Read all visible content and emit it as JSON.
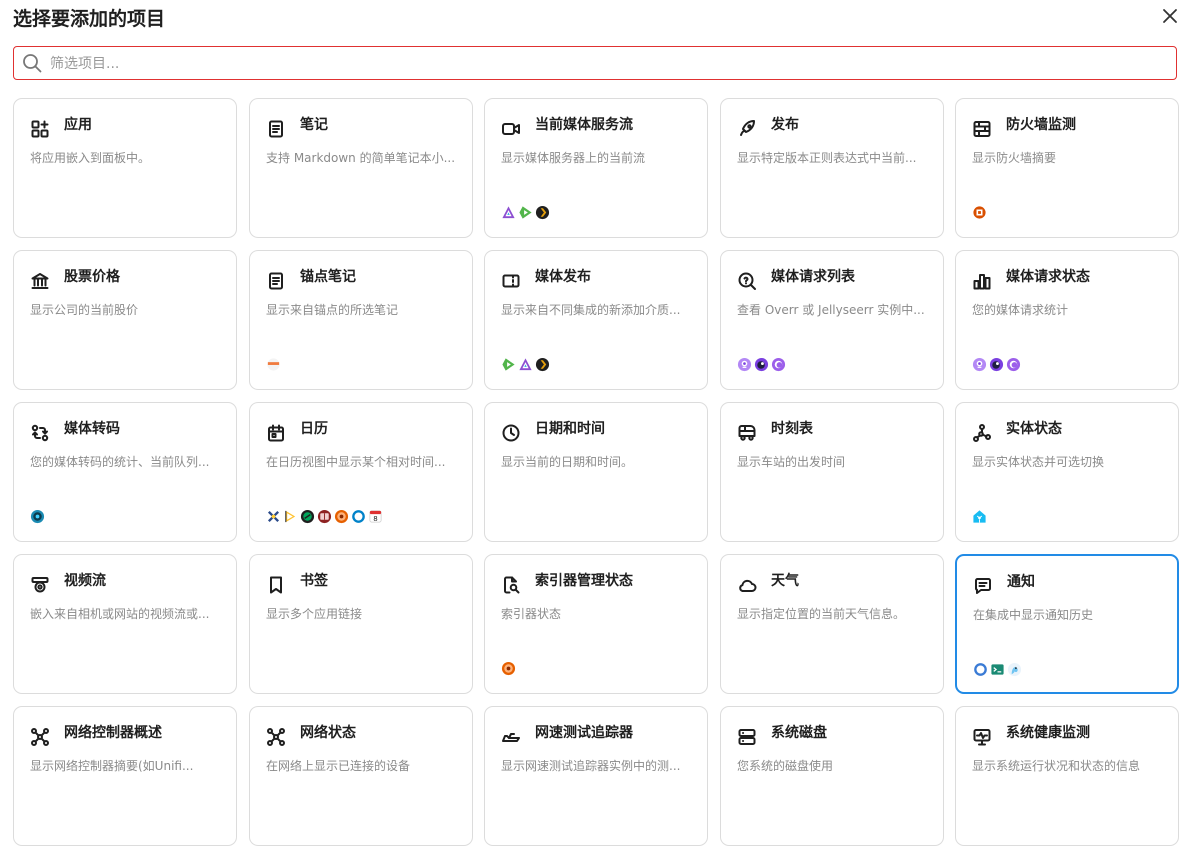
{
  "dialog": {
    "title": "选择要添加的项目",
    "search_placeholder": "筛选项目..."
  },
  "cards": [
    {
      "icon": "apps-icon",
      "title": "应用",
      "desc": "将应用嵌入到面板中。",
      "badges": []
    },
    {
      "icon": "notebook-icon",
      "title": "笔记",
      "desc": "支持 Markdown 的简单笔记本小...",
      "badges": []
    },
    {
      "icon": "video-icon",
      "title": "当前媒体服务流",
      "desc": "显示媒体服务器上的当前流",
      "badges": [
        "jellyfin-logo",
        "emby-logo",
        "plex-logo"
      ]
    },
    {
      "icon": "rocket-icon",
      "title": "发布",
      "desc": "显示特定版本正则表达式中当前...",
      "badges": []
    },
    {
      "icon": "firewall-icon",
      "title": "防火墙监测",
      "desc": "显示防火墙摘要",
      "badges": [
        "opnsense-logo"
      ]
    },
    {
      "icon": "bank-icon",
      "title": "股票价格",
      "desc": "显示公司的当前股价",
      "badges": []
    },
    {
      "icon": "notebook-icon",
      "title": "锚点笔记",
      "desc": "显示来自锚点的所选笔记",
      "badges": [
        "anchor-logo"
      ]
    },
    {
      "icon": "ticket-icon",
      "title": "媒体发布",
      "desc": "显示来自不同集成的新添加介质...",
      "badges": [
        "emby-logo",
        "jellyfin-logo",
        "plex-logo"
      ]
    },
    {
      "icon": "search-question-icon",
      "title": "媒体请求列表",
      "desc": "查看 Overr 或 Jellyseerr 实例中...",
      "badges": [
        "overseerr-logo",
        "jellyseerr-logo",
        "ombi-logo"
      ]
    },
    {
      "icon": "bar-chart-icon",
      "title": "媒体请求状态",
      "desc": "您的媒体请求统计",
      "badges": [
        "overseerr-logo",
        "jellyseerr-logo",
        "ombi-logo"
      ]
    },
    {
      "icon": "transform-icon",
      "title": "媒体转码",
      "desc": "您的媒体转码的统计、当前队列...",
      "badges": [
        "tdarr-logo"
      ]
    },
    {
      "icon": "calendar-icon",
      "title": "日历",
      "desc": "在日历视图中显示某个相对时间...",
      "badges": [
        "radarr-logo",
        "sonarr-logo",
        "lidarr-logo",
        "readarr-logo",
        "prowlarr-logo",
        "nextcloud-logo",
        "calendar-8-logo"
      ]
    },
    {
      "icon": "clock-icon",
      "title": "日期和时间",
      "desc": "显示当前的日期和时间。",
      "badges": []
    },
    {
      "icon": "bus-icon",
      "title": "时刻表",
      "desc": "显示车站的出发时间",
      "badges": []
    },
    {
      "icon": "graph-icon",
      "title": "实体状态",
      "desc": "显示实体状态并可选切换",
      "badges": [
        "homeassistant-logo"
      ]
    },
    {
      "icon": "camera-icon",
      "title": "视频流",
      "desc": "嵌入来自相机或网站的视频流或...",
      "badges": []
    },
    {
      "icon": "bookmark-icon",
      "title": "书签",
      "desc": "显示多个应用链接",
      "badges": []
    },
    {
      "icon": "file-search-icon",
      "title": "索引器管理状态",
      "desc": "索引器状态",
      "badges": [
        "prowlarr-logo"
      ]
    },
    {
      "icon": "cloud-icon",
      "title": "天气",
      "desc": "显示指定位置的当前天气信息。",
      "badges": []
    },
    {
      "icon": "message-icon",
      "title": "通知",
      "desc": "在集成中显示通知历史",
      "badges": [
        "ntfy-logo",
        "terminal-logo",
        "gotify-logo"
      ]
    },
    {
      "icon": "network-icon",
      "title": "网络控制器概述",
      "desc": "显示网络控制器摘要(如Unifi...",
      "badges": []
    },
    {
      "icon": "network-icon",
      "title": "网络状态",
      "desc": "在网络上显示已连接的设备",
      "badges": []
    },
    {
      "icon": "speedboat-icon",
      "title": "网速测试追踪器",
      "desc": "显示网速测试追踪器实例中的测...",
      "badges": []
    },
    {
      "icon": "server-icon",
      "title": "系统磁盘",
      "desc": "您系统的磁盘使用",
      "badges": []
    },
    {
      "icon": "monitor-health-icon",
      "title": "系统健康监测",
      "desc": "显示系统运行状况和状态的信息",
      "badges": []
    }
  ],
  "colors": {
    "search_border": "#e03131",
    "active_border": "#228be6",
    "card_border": "#dcdcdc"
  }
}
